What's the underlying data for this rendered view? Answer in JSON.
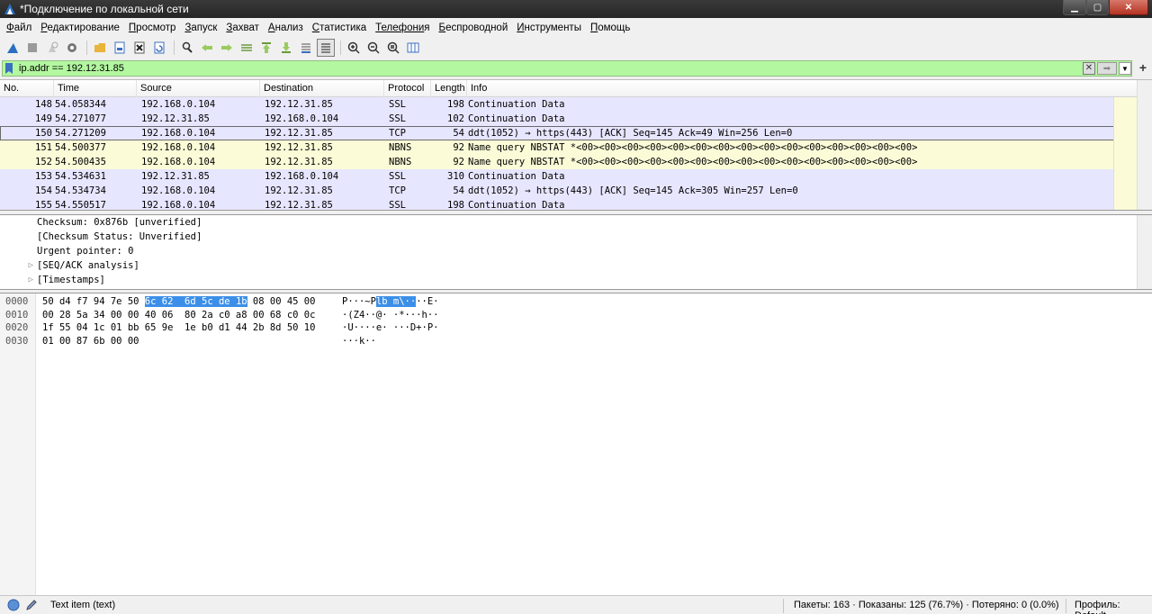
{
  "window": {
    "title": "*Подключение по локальной сети"
  },
  "menu": [
    {
      "label": "Файл",
      "ul": "Ф",
      "rest": "айл"
    },
    {
      "label": "Редактирование",
      "ul": "Р",
      "rest": "едактирование"
    },
    {
      "label": "Просмотр",
      "ul": "П",
      "rest": "росмотр"
    },
    {
      "label": "Запуск",
      "ul": "З",
      "rest": "апуск"
    },
    {
      "label": "Захват",
      "ul": "З",
      "rest": "ахват"
    },
    {
      "label": "Анализ",
      "ul": "А",
      "rest": "нализ"
    },
    {
      "label": "Статистика",
      "ul": "С",
      "rest": "татистика"
    },
    {
      "label": "Телефония",
      "ul": "Телефони",
      "rest": "я"
    },
    {
      "label": "Беспроводной",
      "ul": "Б",
      "rest": "еспроводной"
    },
    {
      "label": "Инструменты",
      "ul": "И",
      "rest": "нструменты"
    },
    {
      "label": "Помощь",
      "ul": "П",
      "rest": "омощь"
    }
  ],
  "filter": {
    "value": "ip.addr == 192.12.31.85"
  },
  "packet_list": {
    "headers": [
      "No.",
      "Time",
      "Source",
      "Destination",
      "Protocol",
      "Length",
      "Info"
    ],
    "rows": [
      {
        "no": "148",
        "time": "54.058344",
        "src": "192.168.0.104",
        "dst": "192.12.31.85",
        "proto": "SSL",
        "len": "198",
        "info": "Continuation Data",
        "kind": "tcp"
      },
      {
        "no": "149",
        "time": "54.271077",
        "src": "192.12.31.85",
        "dst": "192.168.0.104",
        "proto": "SSL",
        "len": "102",
        "info": "Continuation Data",
        "kind": "tcp"
      },
      {
        "no": "150",
        "time": "54.271209",
        "src": "192.168.0.104",
        "dst": "192.12.31.85",
        "proto": "TCP",
        "len": "54",
        "info": "ddt(1052) → https(443) [ACK] Seq=145 Ack=49 Win=256 Len=0",
        "kind": "sel"
      },
      {
        "no": "151",
        "time": "54.500377",
        "src": "192.168.0.104",
        "dst": "192.12.31.85",
        "proto": "NBNS",
        "len": "92",
        "info": "Name query NBSTAT *<00><00><00><00><00><00><00><00><00><00><00><00><00><00><00>",
        "kind": "udp"
      },
      {
        "no": "152",
        "time": "54.500435",
        "src": "192.168.0.104",
        "dst": "192.12.31.85",
        "proto": "NBNS",
        "len": "92",
        "info": "Name query NBSTAT *<00><00><00><00><00><00><00><00><00><00><00><00><00><00><00>",
        "kind": "udp"
      },
      {
        "no": "153",
        "time": "54.534631",
        "src": "192.12.31.85",
        "dst": "192.168.0.104",
        "proto": "SSL",
        "len": "310",
        "info": "Continuation Data",
        "kind": "tcp"
      },
      {
        "no": "154",
        "time": "54.534734",
        "src": "192.168.0.104",
        "dst": "192.12.31.85",
        "proto": "TCP",
        "len": "54",
        "info": "ddt(1052) → https(443) [ACK] Seq=145 Ack=305 Win=257 Len=0",
        "kind": "tcp"
      },
      {
        "no": "155",
        "time": "54.550517",
        "src": "192.168.0.104",
        "dst": "192.12.31.85",
        "proto": "SSL",
        "len": "198",
        "info": "Continuation Data",
        "kind": "tcp"
      }
    ]
  },
  "details": [
    {
      "text": "Checksum: 0x876b [unverified]",
      "expander": ""
    },
    {
      "text": "[Checksum Status: Unverified]",
      "expander": ""
    },
    {
      "text": "Urgent pointer: 0",
      "expander": ""
    },
    {
      "text": "[SEQ/ACK analysis]",
      "expander": "▷"
    },
    {
      "text": "[Timestamps]",
      "expander": "▷"
    }
  ],
  "bytes": [
    {
      "off": "0000",
      "hex_a": "50 d4 f7 94 7e 50 ",
      "hex_hl": "6c 62  6d 5c de 1b",
      "hex_b": " 08 00 45 00",
      "asc_a": "P···~P",
      "asc_hl": "lb m\\··",
      "asc_b": "··E·"
    },
    {
      "off": "0010",
      "hex_a": "00 28 5a 34 00 00 40 06  80 2a c0 a8 00 68 c0 0c",
      "hex_hl": "",
      "hex_b": "",
      "asc_a": "·(Z4··@· ·*···h··",
      "asc_hl": "",
      "asc_b": ""
    },
    {
      "off": "0020",
      "hex_a": "1f 55 04 1c 01 bb 65 9e  1e b0 d1 44 2b 8d 50 10",
      "hex_hl": "",
      "hex_b": "",
      "asc_a": "·U····e· ···D+·P·",
      "asc_hl": "",
      "asc_b": ""
    },
    {
      "off": "0030",
      "hex_a": "01 00 87 6b 00 00",
      "hex_hl": "",
      "hex_b": "",
      "asc_a": "···k··",
      "asc_hl": "",
      "asc_b": ""
    }
  ],
  "status": {
    "item_text": "Text item (text)",
    "packets": "Пакеты: 163 · Показаны: 125 (76.7%) · Потеряно: 0 (0.0%)",
    "profile": "Профиль: Default"
  },
  "colors": {
    "tcp_row": "#e7e6ff",
    "udp_row": "#fbfbd8",
    "filter_ok": "#b3f7a0",
    "byte_highlight": "#3c8fe8"
  }
}
